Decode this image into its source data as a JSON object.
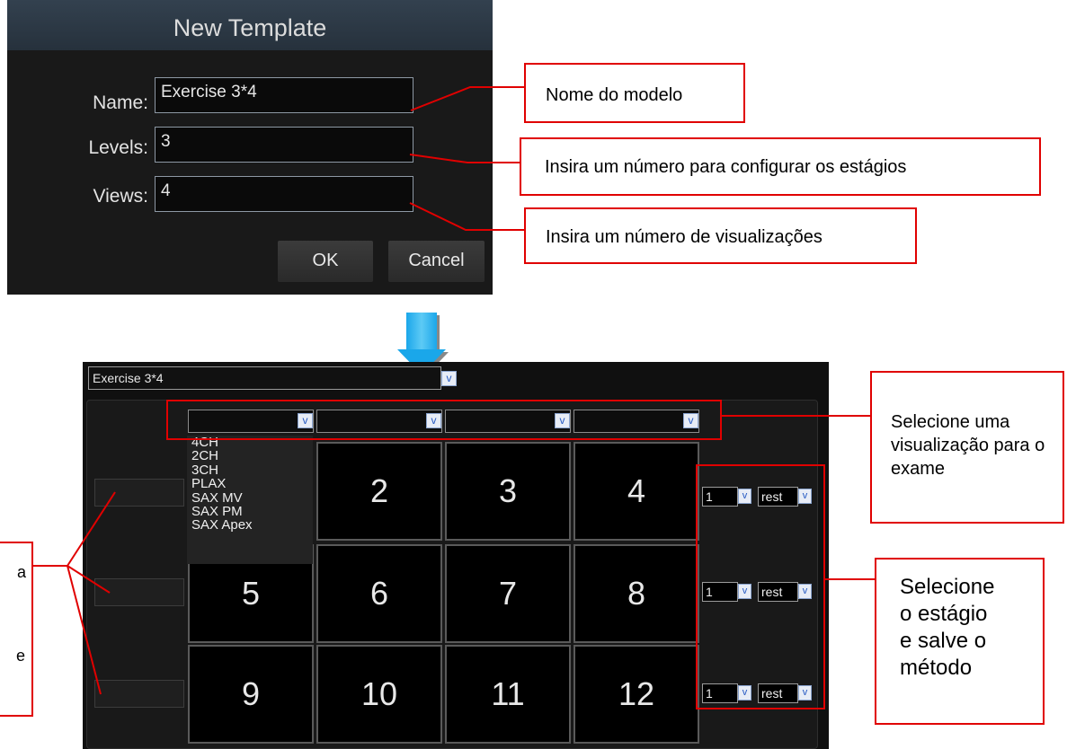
{
  "dialog": {
    "title": "New Template",
    "fields": [
      {
        "label": "Name:",
        "value": "Exercise 3*4"
      },
      {
        "label": "Levels:",
        "value": "3"
      },
      {
        "label": "Views:",
        "value": "4"
      }
    ],
    "ok_label": "OK",
    "cancel_label": "Cancel"
  },
  "panel": {
    "template_value": "Exercise 3*4",
    "view_options": [
      "4CH",
      "2CH",
      "3CH",
      "PLAX",
      "SAX MV",
      "SAX PM",
      "SAX Apex"
    ],
    "cells": [
      "2",
      "3",
      "4",
      "5",
      "6",
      "7",
      "8",
      "9",
      "10",
      "11",
      "12"
    ],
    "rows": [
      {
        "stage": "1",
        "method": "rest"
      },
      {
        "stage": "1",
        "method": "rest"
      },
      {
        "stage": "1",
        "method": "rest"
      }
    ]
  },
  "icons": {
    "dropdown": "chevron-down-icon",
    "arrow": "arrow-down-icon"
  },
  "colors": {
    "callout_border": "#e00000",
    "arrow": "#1aa7ea",
    "dialog_bg": "#191919"
  },
  "callouts": {
    "name": "Nome do modelo",
    "levels": "Insira um número para configurar os estágios",
    "views": "Insira um número de visualizações",
    "select_view": "Selecione uma visualização para o exame",
    "select_stage": "Selecione o estágio e salve o método",
    "left_a": "a",
    "left_e": "e"
  }
}
